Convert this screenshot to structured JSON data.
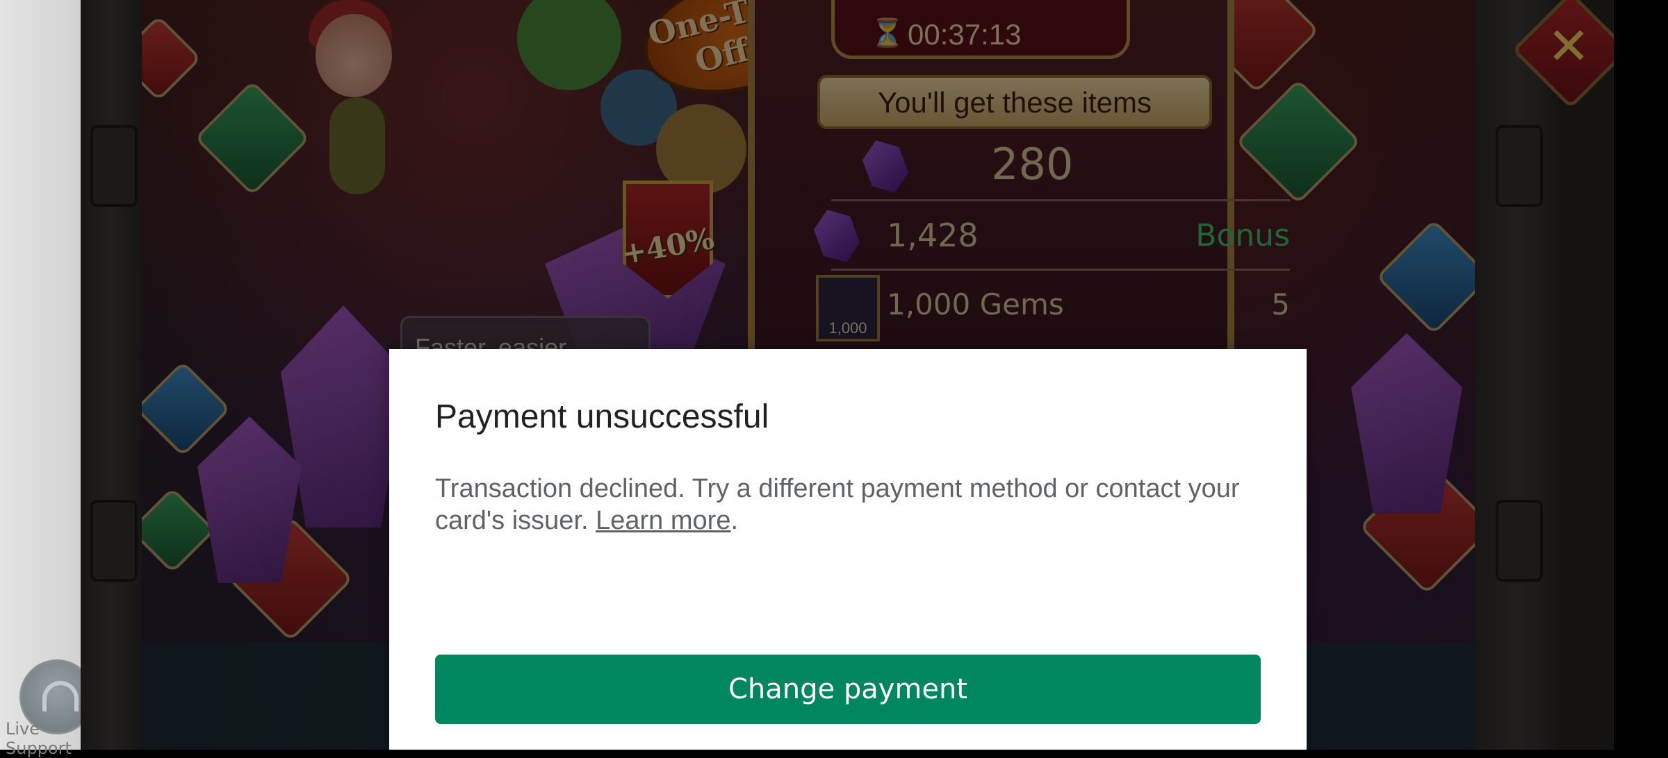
{
  "live_support": {
    "label": "Live Support"
  },
  "game": {
    "offer_badge": "One-Time Offer",
    "timer": "00:37:13",
    "items_header": "You'll get these items",
    "rows": [
      {
        "value": "280"
      },
      {
        "value": "1,428",
        "tag": "Bonus"
      },
      {
        "value": "1,000 Gems",
        "qty": "5",
        "box_label": "1,000"
      }
    ],
    "discount_badge": "+40%",
    "tooltip_text": "Faster, easier, cheaper! Your satisfaction guaranteed"
  },
  "dialog": {
    "title": "Payment unsuccessful",
    "message": "Transaction declined. Try a different payment method or contact your card's issuer.",
    "link": "Learn more",
    "link_suffix": ".",
    "primary_button": "Change payment"
  },
  "colors": {
    "primary_button": "#01875f",
    "bonus_text": "#3ec36e"
  }
}
